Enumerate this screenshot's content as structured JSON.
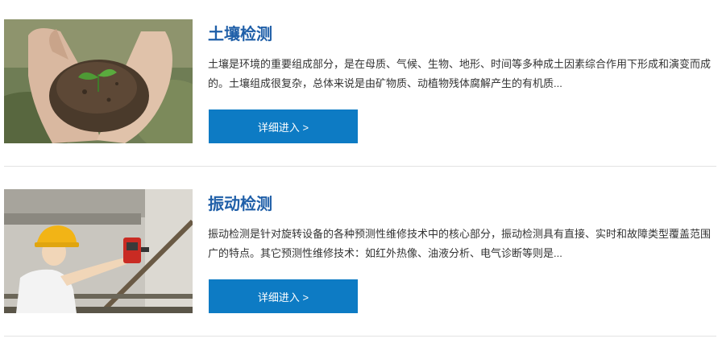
{
  "items": [
    {
      "title": "土壤检测",
      "description": "土壤是环境的重要组成部分，是在母质、气候、生物、地形、时间等多种成土因素综合作用下形成和演变而成的。土壤组成很复杂，总体来说是由矿物质、动植物残体腐解产生的有机质...",
      "button_label": "详细进入 >",
      "image_icon": "hands-holding-soil-sprout"
    },
    {
      "title": "振动检测",
      "description": "振动检测是针对旋转设备的各种预测性维修技术中的核心部分，振动检测具有直接、实时和故障类型覆盖范围广的特点。其它预测性维修技术：如红外热像、油液分析、电气诊断等则是...",
      "button_label": "详细进入 >",
      "image_icon": "worker-vibration-meter"
    }
  ],
  "colors": {
    "title": "#1f5fa8",
    "button": "#0d7bc4",
    "text": "#333333",
    "divider": "#e3e3e3"
  }
}
